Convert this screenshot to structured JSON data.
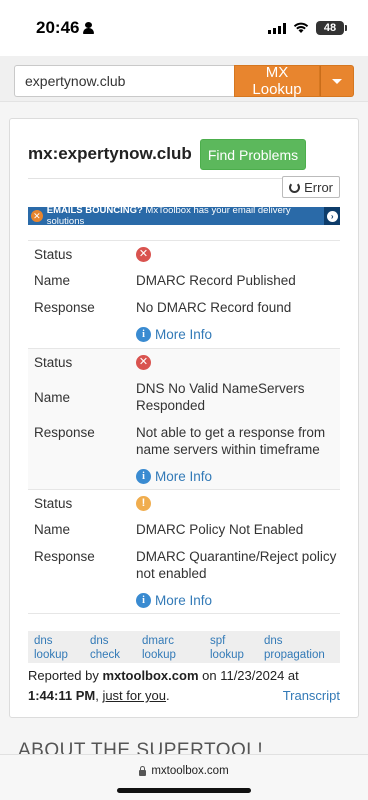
{
  "statusbar": {
    "time": "20:46",
    "battery": "48"
  },
  "search": {
    "value": "expertynow.club",
    "button_label": "MX Lookup"
  },
  "card": {
    "title": "mx:expertynow.club",
    "find_problems_label": "Find Problems",
    "error_label": "Error",
    "banner": {
      "lead": "EMAILS BOUNCING?",
      "text": " MxToolbox has your email delivery solutions"
    }
  },
  "labels": {
    "status": "Status",
    "name": "Name",
    "response": "Response",
    "more_info": "More Info"
  },
  "results": [
    {
      "status": "error",
      "name": "DMARC Record Published",
      "response": "No DMARC Record found"
    },
    {
      "status": "error",
      "name": "DNS No Valid NameServers Responded",
      "response": "Not able to get a response from name servers within timeframe"
    },
    {
      "status": "warning",
      "name": "DMARC Policy Not Enabled",
      "response": "DMARC Quarantine/Reject policy not enabled"
    }
  ],
  "tools": [
    {
      "line1": "dns",
      "line2": "lookup"
    },
    {
      "line1": "dns",
      "line2": "check"
    },
    {
      "line1": "dmarc",
      "line2": "lookup"
    },
    {
      "line1": "spf",
      "line2": "lookup"
    },
    {
      "line1": "dns",
      "line2": "propagation"
    }
  ],
  "footer": {
    "reported_by": "Reported by ",
    "site": "mxtoolbox.com",
    "on": " on 11/23/2024 at",
    "time": "1:44:11 PM",
    "comma": ", ",
    "just_for_you": "just for you",
    "period": ".",
    "transcript": "Transcript"
  },
  "about_heading": "ABOUT THE SUPERTOOL!",
  "browser": {
    "url": "mxtoolbox.com"
  }
}
